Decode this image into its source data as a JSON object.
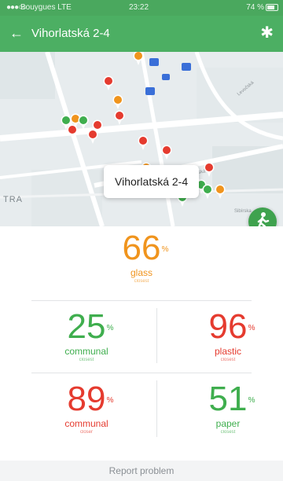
{
  "status_bar": {
    "carrier": "Bouygues  LTE",
    "time": "23:22",
    "battery": "74 %"
  },
  "header": {
    "title": "Vihorlatská 2-4",
    "back_icon": "back-arrow-icon",
    "settings_icon": "gear-icon",
    "color": "#4caf63"
  },
  "map": {
    "callout": "Vihorlatská 2-4",
    "area_label": "TRA",
    "street_labels": [
      "Vihorlatská",
      "Levočská",
      "Sibírska"
    ],
    "marker_colors": {
      "orange": "#f0941d",
      "red": "#e53b2f",
      "green": "#3fae4e"
    },
    "pin_icon": "map-pin-icon",
    "walk_button_icon": "pedestrian-icon"
  },
  "stats": {
    "featured": {
      "value": "66",
      "unit": "%",
      "label": "glass",
      "sub": "closest",
      "color": "#f0941d"
    },
    "grid": [
      {
        "value": "25",
        "unit": "%",
        "label": "communal",
        "sub": "closest",
        "color": "#3fae4e"
      },
      {
        "value": "96",
        "unit": "%",
        "label": "plastic",
        "sub": "closest",
        "color": "#e53b2f"
      },
      {
        "value": "89",
        "unit": "%",
        "label": "communal",
        "sub": "closer",
        "color": "#e53b2f"
      },
      {
        "value": "51",
        "unit": "%",
        "label": "paper",
        "sub": "closest",
        "color": "#3fae4e"
      }
    ]
  },
  "footer": {
    "report_label": "Report problem"
  }
}
